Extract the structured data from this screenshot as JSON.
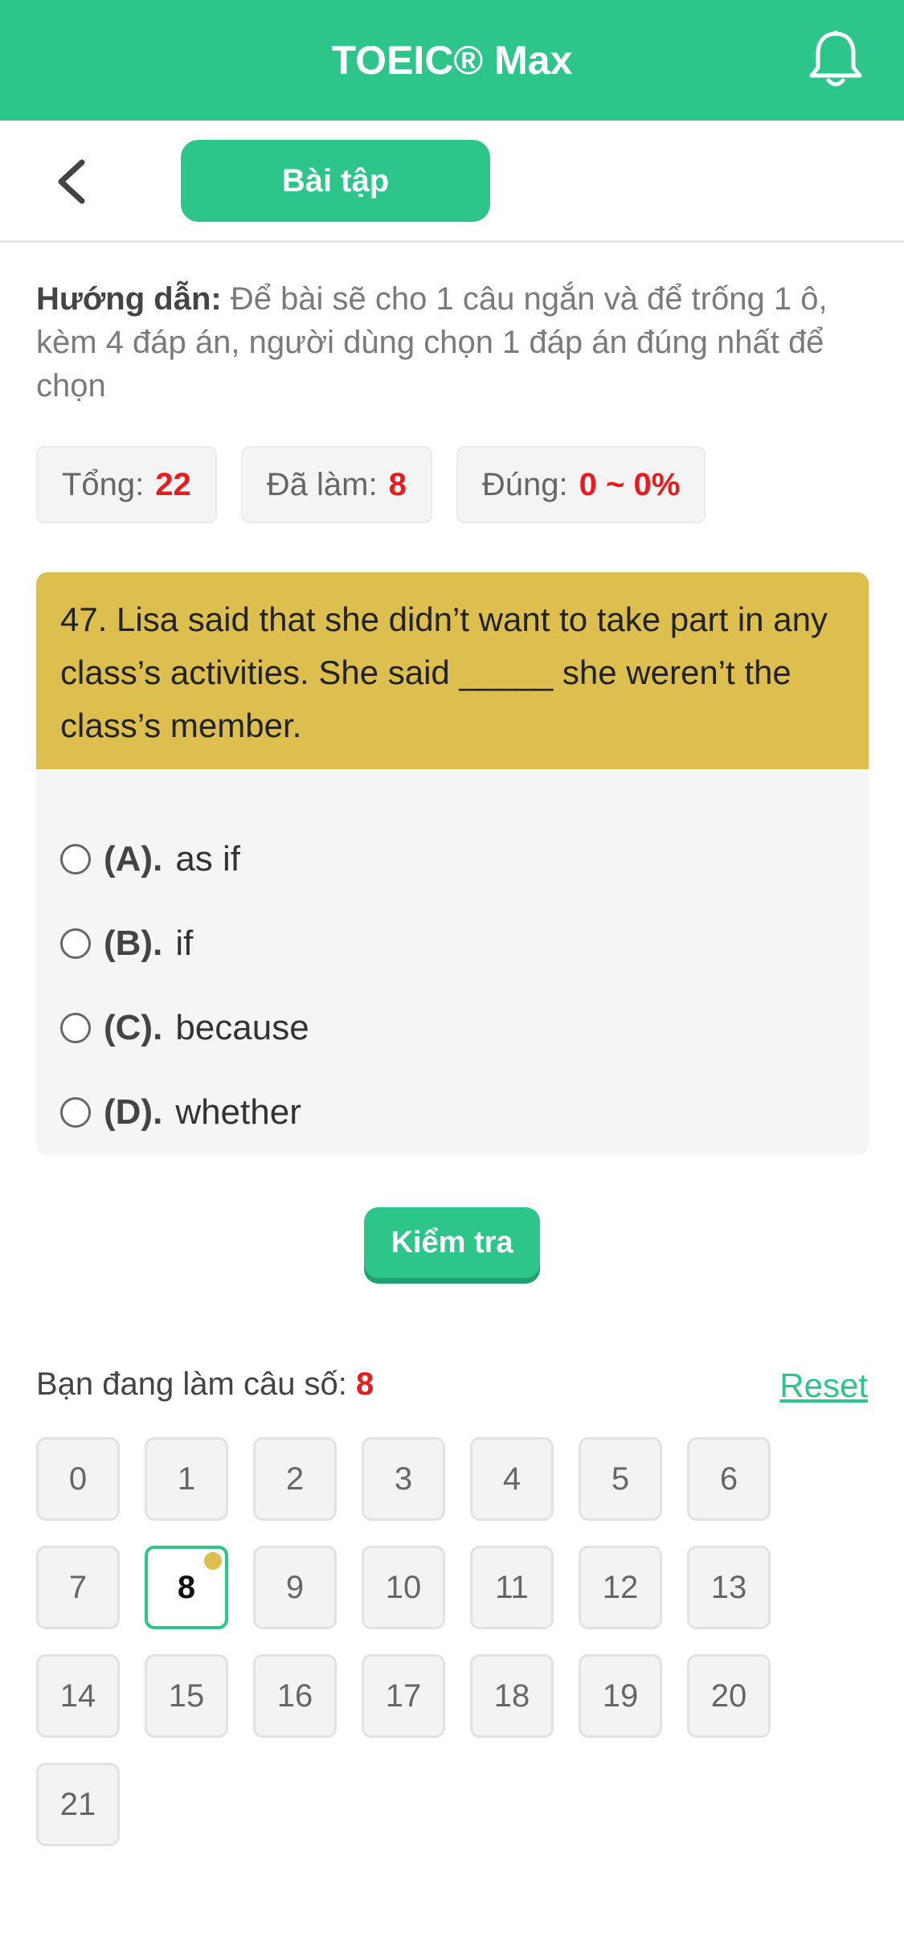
{
  "colors": {
    "brand": "#2dc58a",
    "question_bg": "#dcbf4e",
    "highlight_red": "#e81c1c"
  },
  "app_bar": {
    "title": "TOEIC® Max",
    "right_icon": "bell-icon"
  },
  "sub_header": {
    "back_icon": "chevron-left-icon",
    "tab_label": "Bài tập"
  },
  "instructions": {
    "label": "Hướng dẫn:",
    "text": " Để bài sẽ cho 1 câu ngắn và để trống 1 ô, kèm 4 đáp án, người dùng chọn 1 đáp án đúng nhất để chọn"
  },
  "stats": [
    {
      "label": "Tổng:",
      "value": "22"
    },
    {
      "label": "Đã làm:",
      "value": "8"
    },
    {
      "label": "Đúng:",
      "value": "0 ~ 0%"
    }
  ],
  "question": {
    "text": "47. Lisa said that she didn’t want to take part in any class’s activities. She said _____ she weren’t the class’s member.",
    "options": [
      {
        "letter": "(A).",
        "text": "as if"
      },
      {
        "letter": "(B).",
        "text": "if"
      },
      {
        "letter": "(C).",
        "text": "because"
      },
      {
        "letter": "(D).",
        "text": "whether"
      }
    ]
  },
  "check_button": "Kiểm tra",
  "progress": {
    "label": "Bạn đang làm câu số:",
    "current": "8",
    "reset": "Reset"
  },
  "question_numbers": [
    "0",
    "1",
    "2",
    "3",
    "4",
    "5",
    "6",
    "7",
    "8",
    "9",
    "10",
    "11",
    "12",
    "13",
    "14",
    "15",
    "16",
    "17",
    "18",
    "19",
    "20",
    "21"
  ],
  "current_index": 8
}
